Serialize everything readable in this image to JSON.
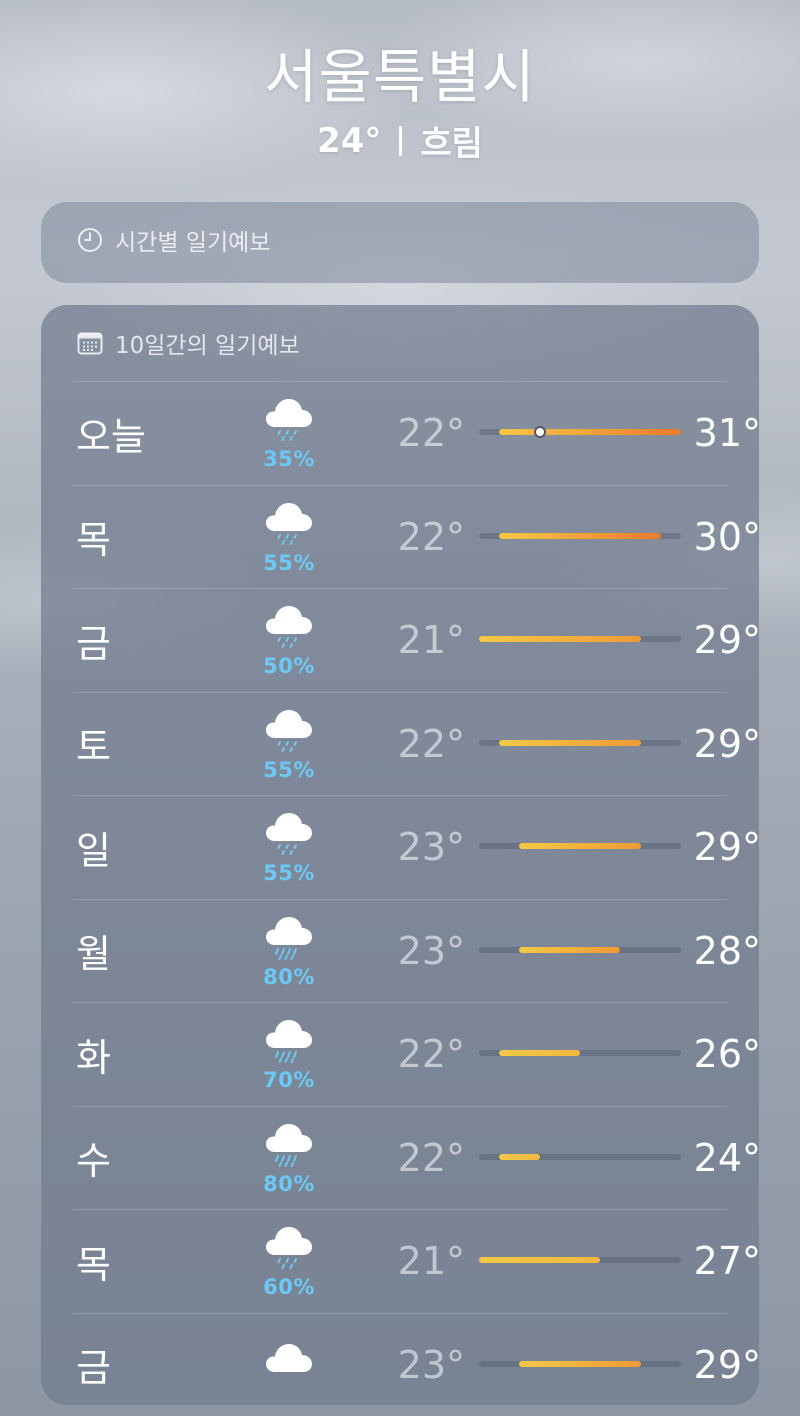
{
  "location": {
    "city": "서울특별시",
    "current_temp": "24°",
    "condition": "흐림"
  },
  "hourly": {
    "title": "시간별 일기예보",
    "icon": "clock-icon"
  },
  "forecast": {
    "title": "10일간의 일기예보",
    "icon": "calendar-icon",
    "range_min": 21,
    "range_max": 31,
    "current_temp_value": 24,
    "days": [
      {
        "day": "오늘",
        "icon": "cloud-rain-icon",
        "precip": "35%",
        "low": "22°",
        "high": "31°",
        "low_val": 22,
        "high_val": 31,
        "today": true
      },
      {
        "day": "목",
        "icon": "cloud-rain-icon",
        "precip": "55%",
        "low": "22°",
        "high": "30°",
        "low_val": 22,
        "high_val": 30
      },
      {
        "day": "금",
        "icon": "cloud-rain-icon",
        "precip": "50%",
        "low": "21°",
        "high": "29°",
        "low_val": 21,
        "high_val": 29
      },
      {
        "day": "토",
        "icon": "cloud-rain-icon",
        "precip": "55%",
        "low": "22°",
        "high": "29°",
        "low_val": 22,
        "high_val": 29
      },
      {
        "day": "일",
        "icon": "cloud-rain-icon",
        "precip": "55%",
        "low": "23°",
        "high": "29°",
        "low_val": 23,
        "high_val": 29
      },
      {
        "day": "월",
        "icon": "cloud-heavy-rain-icon",
        "precip": "80%",
        "low": "23°",
        "high": "28°",
        "low_val": 23,
        "high_val": 28
      },
      {
        "day": "화",
        "icon": "cloud-heavy-rain-icon",
        "precip": "70%",
        "low": "22°",
        "high": "26°",
        "low_val": 22,
        "high_val": 26
      },
      {
        "day": "수",
        "icon": "cloud-heavy-rain-icon",
        "precip": "80%",
        "low": "22°",
        "high": "24°",
        "low_val": 22,
        "high_val": 24
      },
      {
        "day": "목",
        "icon": "cloud-rain-icon",
        "precip": "60%",
        "low": "21°",
        "high": "27°",
        "low_val": 21,
        "high_val": 27
      },
      {
        "day": "금",
        "icon": "cloud-icon",
        "precip": "",
        "low": "23°",
        "high": "29°",
        "low_val": 23,
        "high_val": 29
      }
    ]
  },
  "colors": {
    "precip": "#6ec8f4",
    "bar_yellow": "#f2c744",
    "bar_orange": "#ef8f34",
    "bar_red_orange": "#ec7b2d"
  }
}
